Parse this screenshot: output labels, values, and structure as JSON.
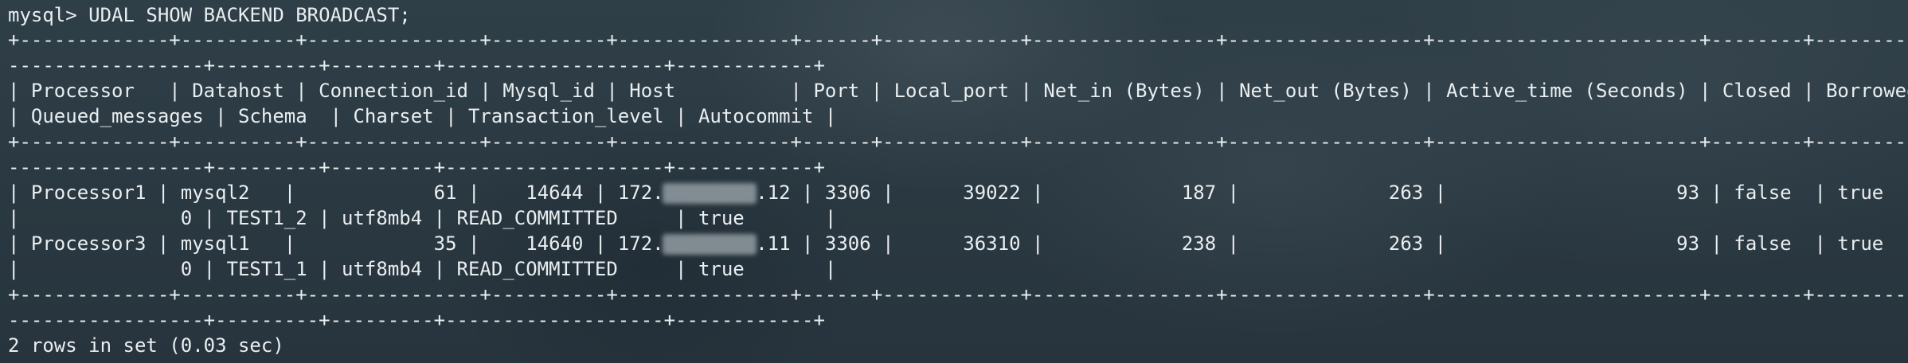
{
  "terminal": {
    "command_line": "mysql> UDAL SHOW BACKEND BROADCAST;",
    "lines": [
      "+-------------+----------+---------------+----------+---------------+------+------------+----------------+-----------------+-----------------------+--------+----------",
      "-----------------+---------+---------+-------------------+------------+",
      "| Processor   | Datahost | Connection_id | Mysql_id | Host          | Port | Local_port | Net_in (Bytes) | Net_out (Bytes) | Active_time (Seconds) | Closed | Borrowed",
      "| Queued_messages | Schema  | Charset | Transaction_level | Autocommit |",
      "+-------------+----------+---------------+----------+---------------+------+------------+----------------+-----------------+-----------------------+--------+----------",
      "-----------------+---------+---------+-------------------+------------+",
      "| Processor1 | mysql2   |            61 |    14644 | 172.        .12 | 3306 |      39022 |            187 |             263 |                    93 | false  | true",
      "|              0 | TEST1_2 | utf8mb4 | READ_COMMITTED     | true       |",
      "| Processor3 | mysql1   |            35 |    14640 | 172.        .11 | 3306 |      36310 |            238 |             263 |                    93 | false  | true",
      "|              0 | TEST1_1 | utf8mb4 | READ_COMMITTED     | true       |",
      "+-------------+----------+---------------+----------+---------------+------+------------+----------------+-----------------+-----------------------+--------+----------",
      "-----------------+---------+---------+-------------------+------------+"
    ],
    "result_line": "2 rows in set (0.03 sec)"
  }
}
